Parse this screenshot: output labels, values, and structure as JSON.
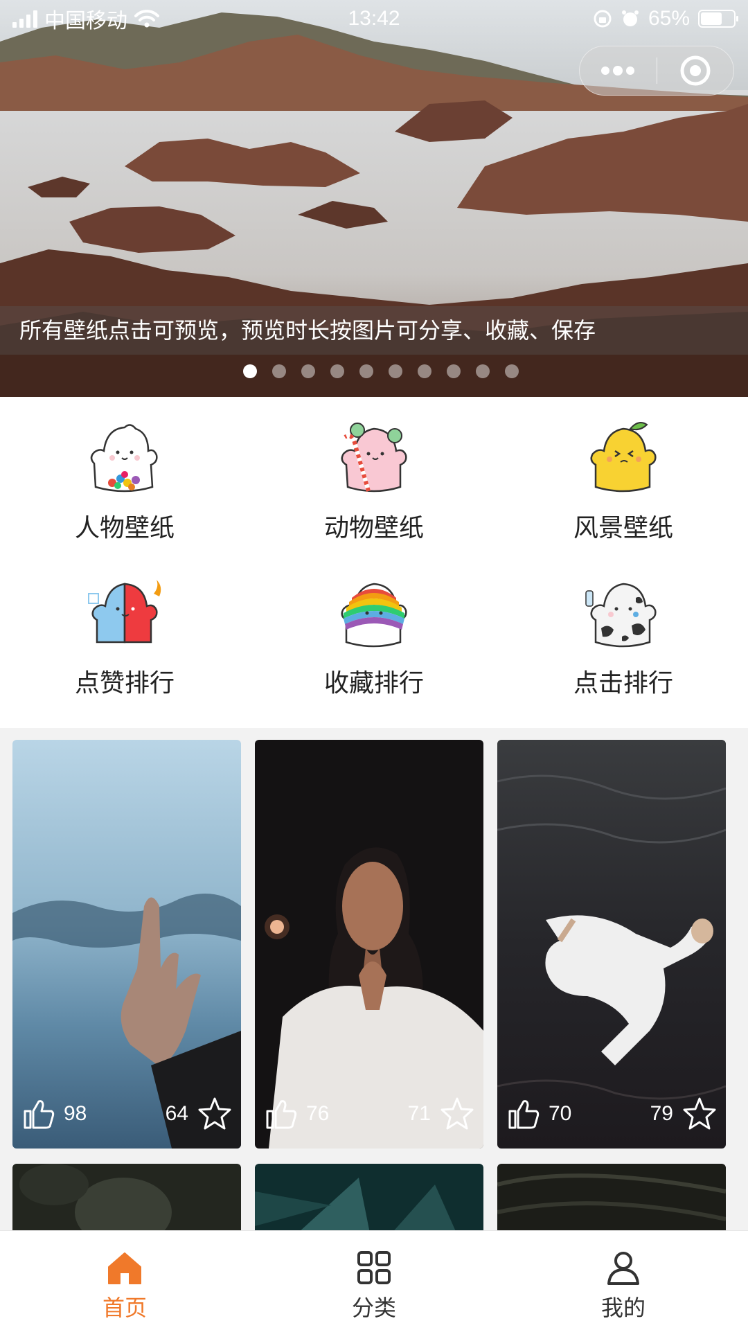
{
  "status_bar": {
    "carrier": "中国移动",
    "time": "13:42",
    "battery": "65%",
    "battery_level": 0.65
  },
  "banner": {
    "notice": "所有壁纸点击可预览，预览时长按图片可分享、收藏、保存",
    "slide_count": 10,
    "active_slide": 0
  },
  "categories": [
    {
      "label": "人物壁纸",
      "icon": "ghost-candy-icon"
    },
    {
      "label": "动物壁纸",
      "icon": "ghost-candycane-icon"
    },
    {
      "label": "风景壁纸",
      "icon": "ghost-lemon-icon"
    },
    {
      "label": "点赞排行",
      "icon": "ghost-fire-ice-icon"
    },
    {
      "label": "收藏排行",
      "icon": "ghost-rainbow-icon"
    },
    {
      "label": "点击排行",
      "icon": "ghost-cow-icon"
    }
  ],
  "wallpapers": [
    {
      "likes": "98",
      "favorites": "64",
      "subject": "hand on rainy window"
    },
    {
      "likes": "76",
      "favorites": "71",
      "subject": "woman in white sweater"
    },
    {
      "likes": "70",
      "favorites": "79",
      "subject": "person floating in water"
    }
  ],
  "tabs": [
    {
      "label": "首页",
      "icon": "home-icon",
      "active": true
    },
    {
      "label": "分类",
      "icon": "grid-icon",
      "active": false
    },
    {
      "label": "我的",
      "icon": "user-icon",
      "active": false
    }
  ],
  "colors": {
    "accent": "#f0792a",
    "background": "#f2f2f2"
  }
}
